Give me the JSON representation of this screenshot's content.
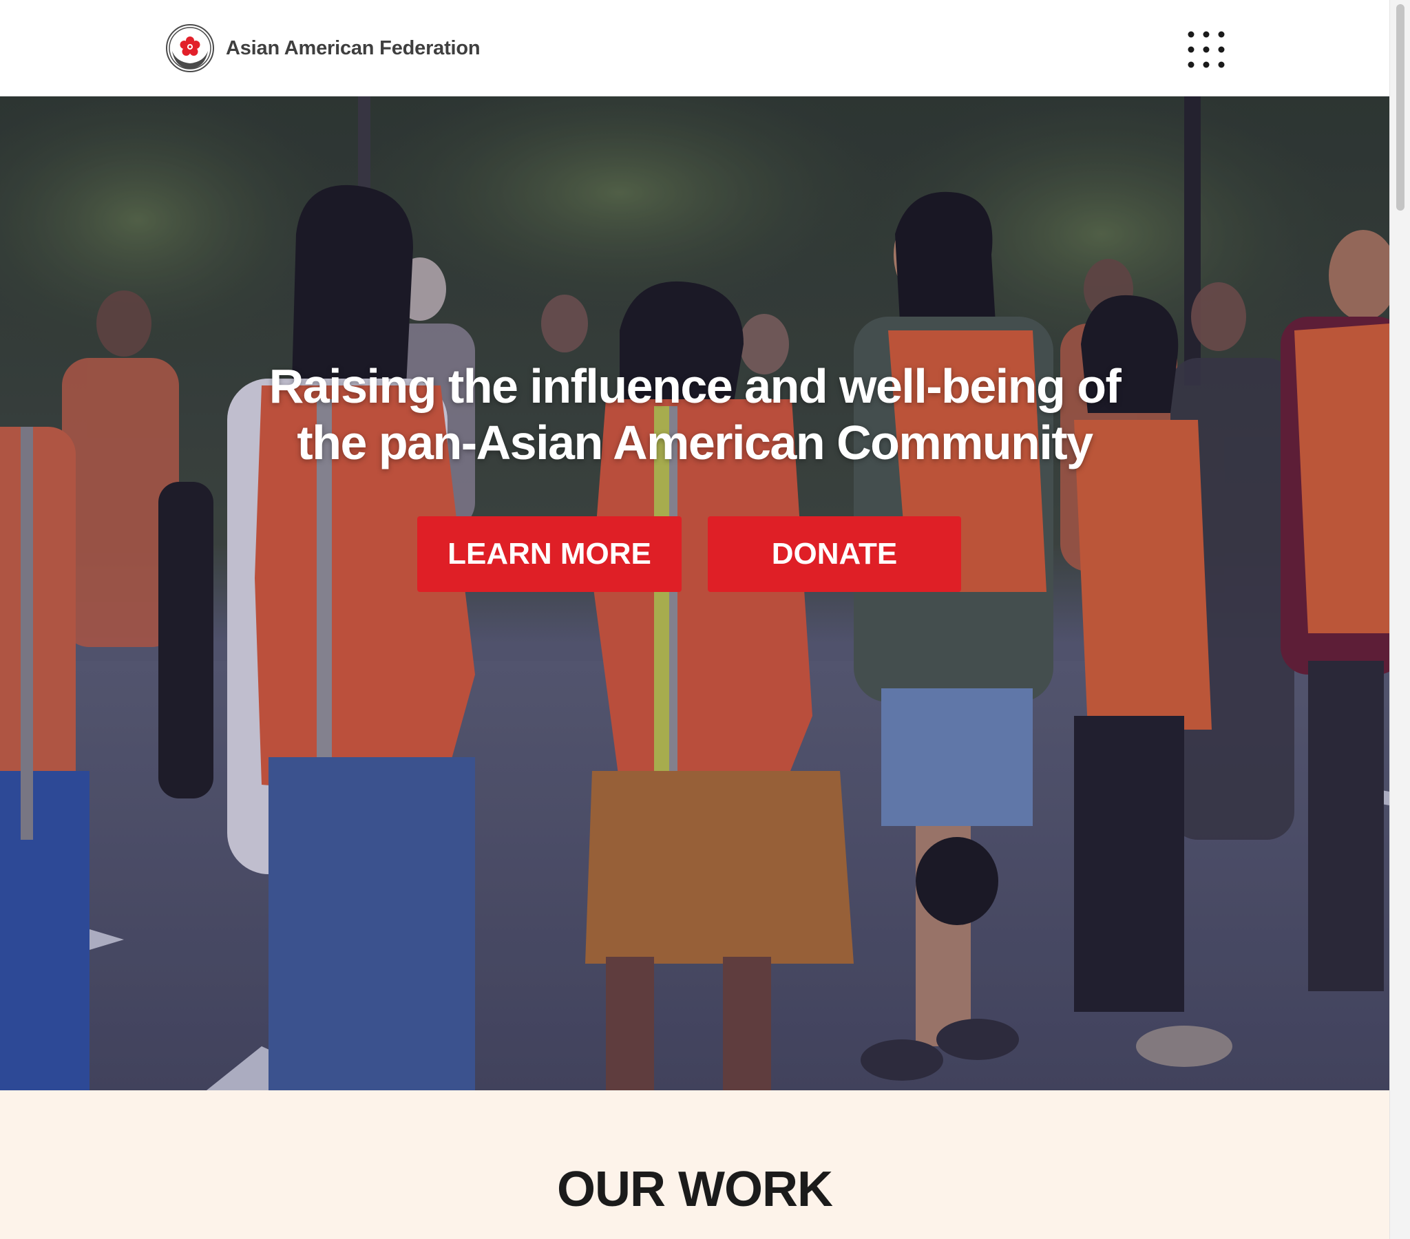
{
  "header": {
    "logo_text": "Asian American Federation",
    "menu_icon": "grid-menu-icon"
  },
  "hero": {
    "heading_line1": "Raising the influence and well-being of",
    "heading_line2": "the pan-Asian American Community",
    "learn_more_label": "LEARN MORE",
    "donate_label": "DONATE",
    "photo_description_icon": "hero-photo-marchers"
  },
  "our_work": {
    "title": "OUR WORK"
  },
  "colors": {
    "accent_red": "#df1f26",
    "section_bg": "#fdf3ea",
    "header_text": "#3f3f3f"
  }
}
